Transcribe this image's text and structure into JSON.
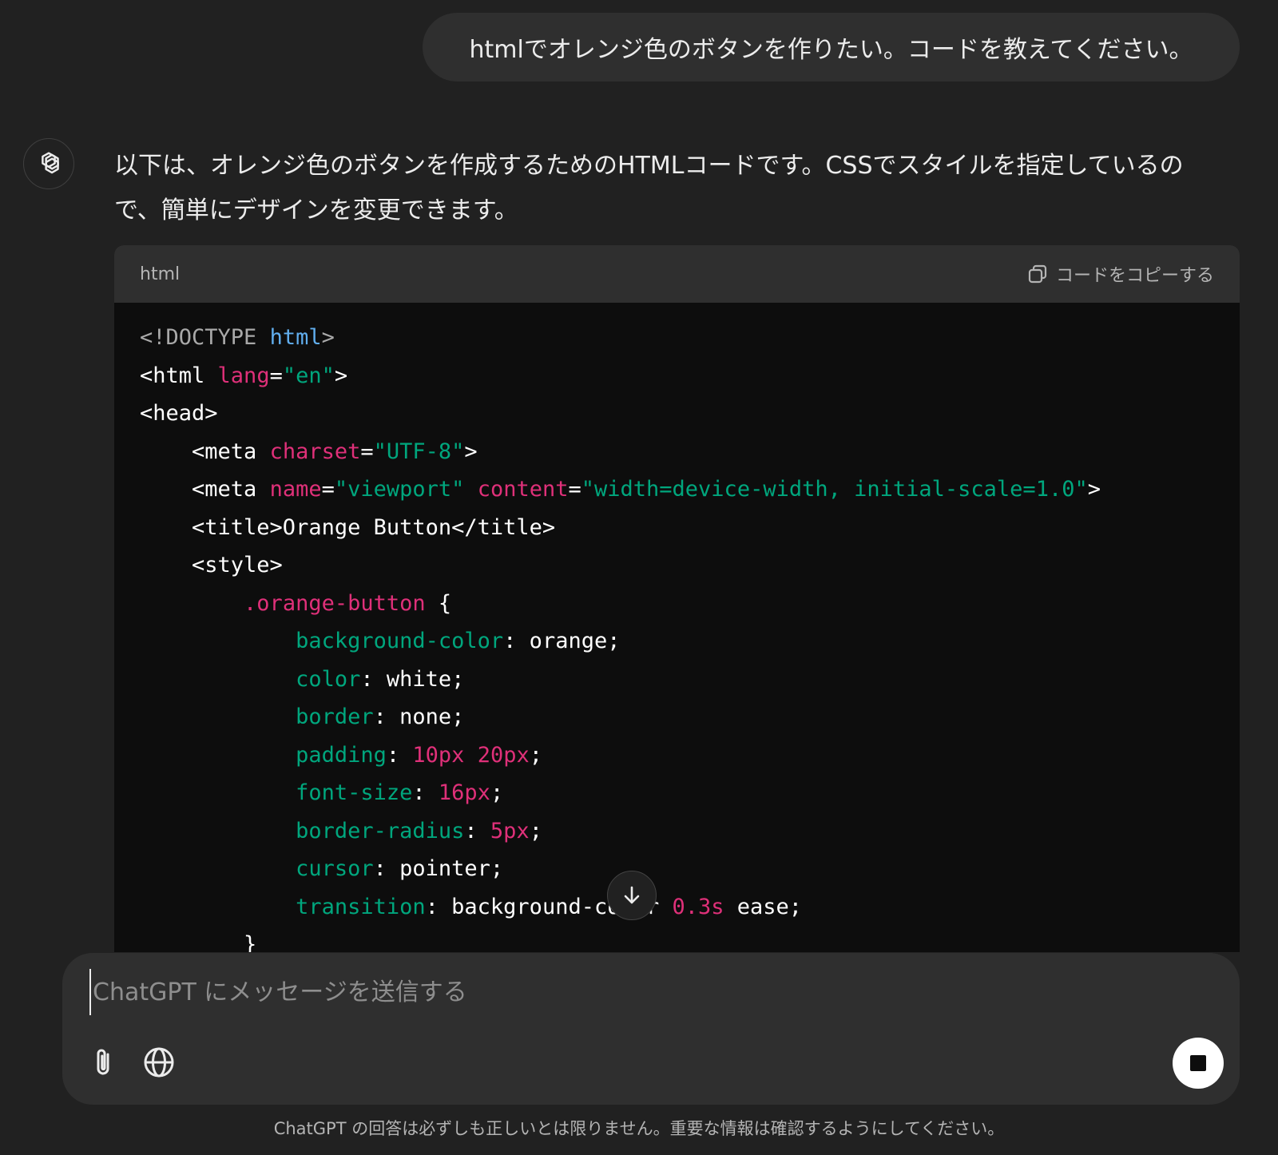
{
  "conversation": {
    "user_message": "htmlでオレンジ色のボタンを作りたい。コードを教えてください。",
    "assistant": {
      "avatar_icon": "openai-logo-icon",
      "intro_line1": "以下は、オレンジ色のボタンを作成するためのHTMLコードです。CSSでスタイルを指定しているの",
      "intro_line2": "で、簡単にデザインを変更できます。",
      "code": {
        "language": "html",
        "copy_label": "コードをコピーする",
        "copy_icon": "copy-icon",
        "lines": [
          [
            {
              "t": "<!DOCTYPE ",
              "c": "gray"
            },
            {
              "t": "html",
              "c": "blue"
            },
            {
              "t": ">",
              "c": "gray"
            }
          ],
          [
            {
              "t": "<html ",
              "c": "val"
            },
            {
              "t": "lang",
              "c": "pink"
            },
            {
              "t": "=",
              "c": "val"
            },
            {
              "t": "\"en\"",
              "c": "green"
            },
            {
              "t": ">",
              "c": "val"
            }
          ],
          [
            {
              "t": "<head>",
              "c": "val"
            }
          ],
          [
            {
              "t": "    <meta ",
              "c": "val"
            },
            {
              "t": "charset",
              "c": "pink"
            },
            {
              "t": "=",
              "c": "val"
            },
            {
              "t": "\"UTF-8\"",
              "c": "green"
            },
            {
              "t": ">",
              "c": "val"
            }
          ],
          [
            {
              "t": "    <meta ",
              "c": "val"
            },
            {
              "t": "name",
              "c": "pink"
            },
            {
              "t": "=",
              "c": "val"
            },
            {
              "t": "\"viewport\"",
              "c": "green"
            },
            {
              "t": " ",
              "c": "val"
            },
            {
              "t": "content",
              "c": "pink"
            },
            {
              "t": "=",
              "c": "val"
            },
            {
              "t": "\"width=device-width, initial-scale=1.0\"",
              "c": "green"
            },
            {
              "t": ">",
              "c": "val"
            }
          ],
          [
            {
              "t": "    <title>Orange Button</title>",
              "c": "val"
            }
          ],
          [
            {
              "t": "    <style>",
              "c": "val"
            }
          ],
          [
            {
              "t": "        ",
              "c": "val"
            },
            {
              "t": ".orange-button",
              "c": "pink"
            },
            {
              "t": " {",
              "c": "val"
            }
          ],
          [
            {
              "t": "            ",
              "c": "val"
            },
            {
              "t": "background-color",
              "c": "green"
            },
            {
              "t": ": orange;",
              "c": "val"
            }
          ],
          [
            {
              "t": "            ",
              "c": "val"
            },
            {
              "t": "color",
              "c": "green"
            },
            {
              "t": ": white;",
              "c": "val"
            }
          ],
          [
            {
              "t": "            ",
              "c": "val"
            },
            {
              "t": "border",
              "c": "green"
            },
            {
              "t": ": none;",
              "c": "val"
            }
          ],
          [
            {
              "t": "            ",
              "c": "val"
            },
            {
              "t": "padding",
              "c": "green"
            },
            {
              "t": ": ",
              "c": "val"
            },
            {
              "t": "10px",
              "c": "pink"
            },
            {
              "t": " ",
              "c": "val"
            },
            {
              "t": "20px",
              "c": "pink"
            },
            {
              "t": ";",
              "c": "val"
            }
          ],
          [
            {
              "t": "            ",
              "c": "val"
            },
            {
              "t": "font-size",
              "c": "green"
            },
            {
              "t": ": ",
              "c": "val"
            },
            {
              "t": "16px",
              "c": "pink"
            },
            {
              "t": ";",
              "c": "val"
            }
          ],
          [
            {
              "t": "            ",
              "c": "val"
            },
            {
              "t": "border-radius",
              "c": "green"
            },
            {
              "t": ": ",
              "c": "val"
            },
            {
              "t": "5px",
              "c": "pink"
            },
            {
              "t": ";",
              "c": "val"
            }
          ],
          [
            {
              "t": "            ",
              "c": "val"
            },
            {
              "t": "cursor",
              "c": "green"
            },
            {
              "t": ": pointer;",
              "c": "val"
            }
          ],
          [
            {
              "t": "            ",
              "c": "val"
            },
            {
              "t": "transition",
              "c": "green"
            },
            {
              "t": ": background-color ",
              "c": "val"
            },
            {
              "t": "0.3s",
              "c": "pink"
            },
            {
              "t": " ease;",
              "c": "val"
            }
          ],
          [
            {
              "t": "        }",
              "c": "val"
            }
          ]
        ]
      }
    },
    "scroll_down_icon": "arrow-down-icon"
  },
  "composer": {
    "placeholder": "ChatGPT にメッセージを送信する",
    "attach_icon": "paperclip-icon",
    "web_icon": "globe-icon",
    "stop_icon": "stop-icon"
  },
  "footer": {
    "disclaimer": "ChatGPT の回答は必ずしも正しいとは限りません。重要な情報は確認するようにしてください。"
  },
  "colors": {
    "background": "#212121",
    "surface": "#2f2f2f",
    "code_bg": "#0d0d0d",
    "token_pink": "#df3079",
    "token_green": "#00a67d",
    "token_blue": "#61aeee",
    "token_gray": "#a9a9a9"
  }
}
